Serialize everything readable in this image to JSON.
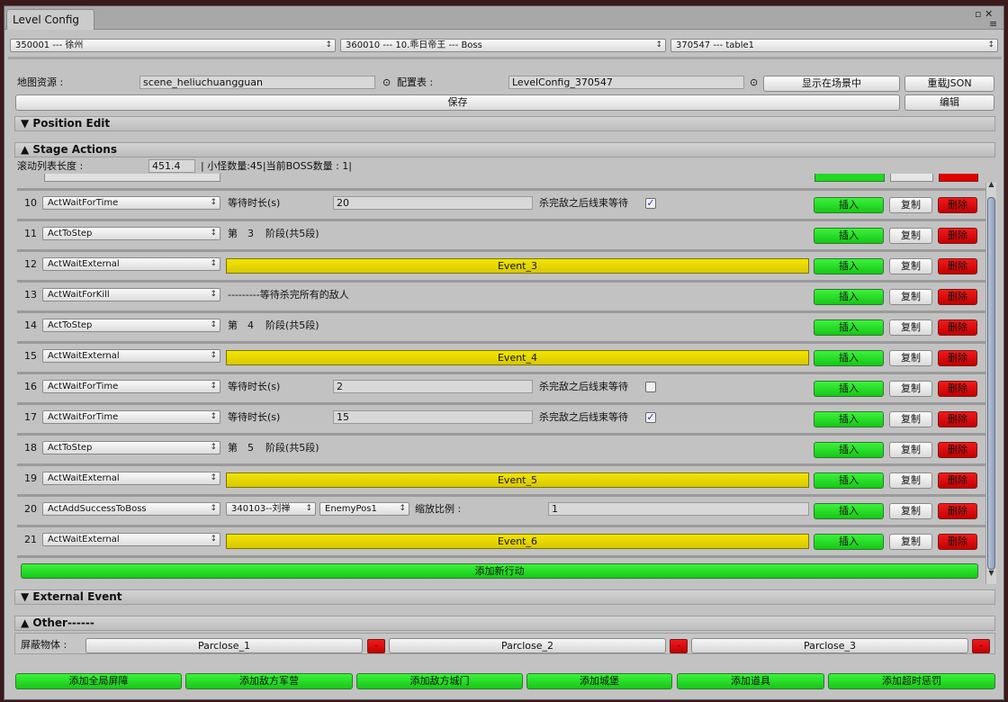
{
  "window": {
    "tab_title": "Level Config",
    "ctl_top": "▫ ✕",
    "ctl_menu": "≡"
  },
  "selectors": [
    {
      "value": "350001  --- 徐州"
    },
    {
      "value": "360010 --- 10.乖日帝王 --- Boss"
    },
    {
      "value": "370547  --- table1"
    }
  ],
  "config": {
    "map_label": "地图资源 :",
    "map_value": "scene_heliuchuangguan",
    "table_label": "配置表 :",
    "table_value": "LevelConfig_370547",
    "show_btn": "显示在场景中",
    "reload_btn": "重载JSON",
    "save_btn": "保存",
    "edit_btn": "编辑",
    "pick_icon": "⊙"
  },
  "sections": {
    "position_edit": "▼ Position Edit",
    "stage_actions": "▲ Stage Actions",
    "external_event": "▼ External Event",
    "other": "▲ Other------"
  },
  "stage": {
    "scroll_len_label": "滚动列表长度 :",
    "scroll_len_value": "451.4",
    "counts_text": "| 小怪数量:45|当前BOSS数量 : 1|",
    "add_action_btn": "添加新行动"
  },
  "row_buttons": {
    "insert": "插入",
    "copy": "复制",
    "delete": "删除"
  },
  "rows": [
    {
      "num": "10",
      "action": "ActWaitForTime",
      "kind": "time",
      "p_label": "等待时长(s)",
      "p_value": "20",
      "wait_label": "杀完敌之后线束等待",
      "checked": "✓"
    },
    {
      "num": "11",
      "action": "ActToStep",
      "kind": "step",
      "s1": "第",
      "s2": "3",
      "s3": "阶段(共5段)"
    },
    {
      "num": "12",
      "action": "ActWaitExternal",
      "kind": "event",
      "event": "Event_3"
    },
    {
      "num": "13",
      "action": "ActWaitForKill",
      "kind": "kill",
      "text": "---------等待杀完所有的敌人"
    },
    {
      "num": "14",
      "action": "ActToStep",
      "kind": "step",
      "s1": "第",
      "s2": "4",
      "s3": "阶段(共5段)"
    },
    {
      "num": "15",
      "action": "ActWaitExternal",
      "kind": "event",
      "event": "Event_4"
    },
    {
      "num": "16",
      "action": "ActWaitForTime",
      "kind": "time",
      "p_label": "等待时长(s)",
      "p_value": "2",
      "wait_label": "杀完敌之后线束等待",
      "checked": ""
    },
    {
      "num": "17",
      "action": "ActWaitForTime",
      "kind": "time",
      "p_label": "等待时长(s)",
      "p_value": "15",
      "wait_label": "杀完敌之后线束等待",
      "checked": "✓"
    },
    {
      "num": "18",
      "action": "ActToStep",
      "kind": "step",
      "s1": "第",
      "s2": "5",
      "s3": "阶段(共5段)"
    },
    {
      "num": "19",
      "action": "ActWaitExternal",
      "kind": "event",
      "event": "Event_5"
    },
    {
      "num": "20",
      "action": "ActAddSuccessToBoss",
      "kind": "boss",
      "boss": "340103--刘禅",
      "pos": "EnemyPos1",
      "scale_label": "缩放比例 :",
      "scale_value": "1"
    },
    {
      "num": "21",
      "action": "ActWaitExternal",
      "kind": "event",
      "event": "Event_6"
    }
  ],
  "other": {
    "shield_label": "屏蔽物体 :",
    "items": [
      "Parclose_1",
      "Parclose_2",
      "Parclose_3"
    ],
    "remove": "-"
  },
  "bottom_buttons": [
    "添加全局屏障",
    "添加敌方军营",
    "添加敌方城门",
    "添加城堡",
    "添加道具",
    "添加超时惩罚"
  ],
  "scroll": {
    "up": "▲",
    "down": "▼"
  },
  "colors": {
    "green": "#22d822",
    "red": "#e00000",
    "yellow": "#e8d800"
  }
}
